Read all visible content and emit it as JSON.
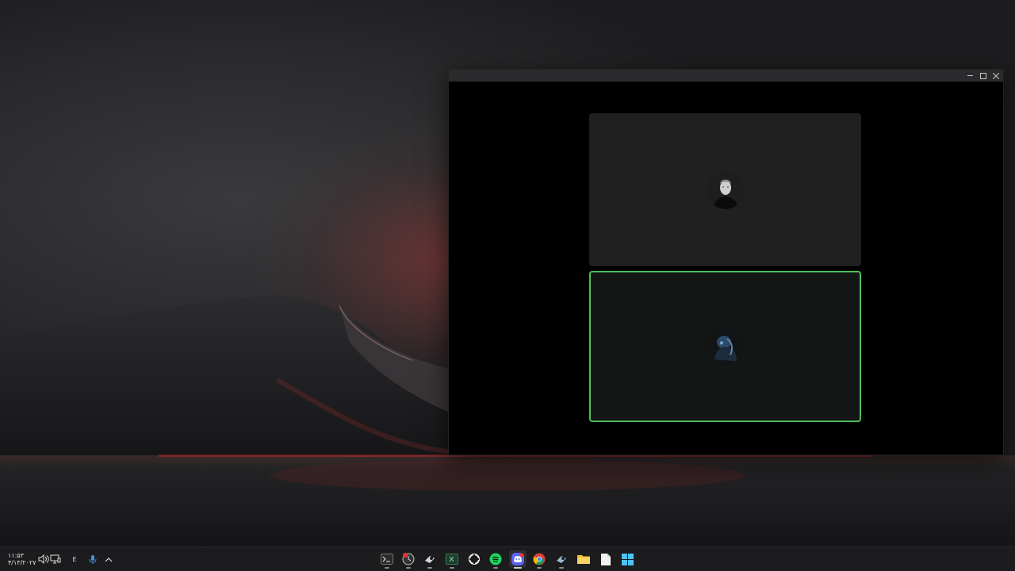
{
  "taskbar": {
    "clock_time": "۱۱:۵۳",
    "clock_date": "۴/۱۳/۲۰۲۷",
    "language": "E",
    "apps": [
      {
        "name": "terminal-app-icon"
      },
      {
        "name": "osu-app-icon"
      },
      {
        "name": "steam-app-icon"
      },
      {
        "name": "excel-app-icon"
      },
      {
        "name": "github-desktop-app-icon"
      },
      {
        "name": "spotify-app-icon"
      },
      {
        "name": "discord-app-icon"
      },
      {
        "name": "chrome-app-icon"
      },
      {
        "name": "steam-app-icon-2"
      },
      {
        "name": "file-explorer-app-icon"
      },
      {
        "name": "notepad-app-icon"
      },
      {
        "name": "start-menu-icon"
      }
    ]
  },
  "colors": {
    "speaking_border": "#4fbf59",
    "window_bg": "#000000",
    "taskbar_bg": "#1c1c1e"
  }
}
